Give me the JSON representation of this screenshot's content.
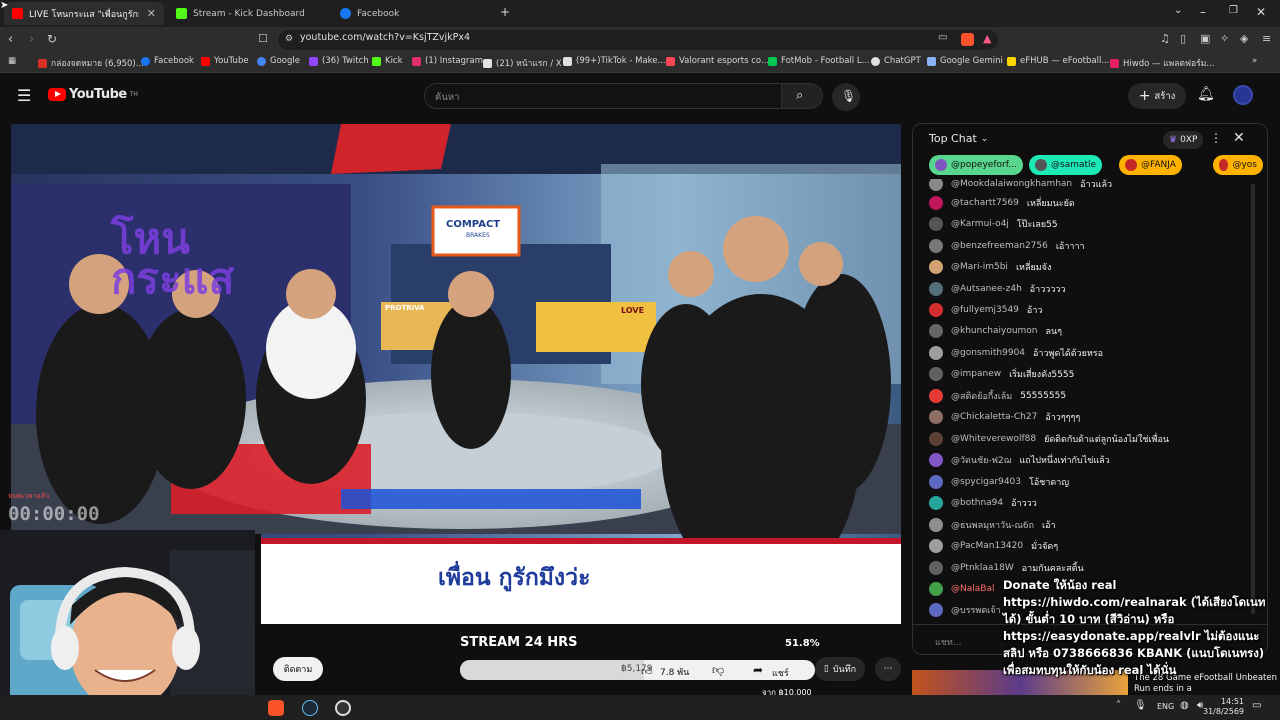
{
  "browser": {
    "tabs": [
      {
        "label": "LIVE โหนกระแส \"เพื่อนกูรักมึงว่ะ",
        "icon": "youtube-icon",
        "active": true
      },
      {
        "label": "Stream - Kick Dashboard",
        "icon": "kick-icon",
        "active": false
      },
      {
        "label": "Facebook",
        "icon": "facebook-icon",
        "active": false
      }
    ],
    "url": "youtube.com/watch?v=KsjTZvjkPx4",
    "bookmarks": [
      {
        "label": "กล่องจดหมาย (6,950)...",
        "color": "#d93025"
      },
      {
        "label": "Facebook",
        "color": "#1877f2"
      },
      {
        "label": "YouTube",
        "color": "#ff0000"
      },
      {
        "label": "Google",
        "color": "#4285f4"
      },
      {
        "label": "(36) Twitch",
        "color": "#9146ff"
      },
      {
        "label": "Kick",
        "color": "#53fc18"
      },
      {
        "label": "(1) Instagram",
        "color": "#e1306c"
      },
      {
        "label": "(21) หน้าแรก / X",
        "color": "#e0e0e0"
      },
      {
        "label": "(99+)TikTok - Make...",
        "color": "#e0e0e0"
      },
      {
        "label": "Valorant esports co...",
        "color": "#ff4655"
      },
      {
        "label": "FotMob - Football L...",
        "color": "#00c853"
      },
      {
        "label": "ChatGPT",
        "color": "#e0e0e0"
      },
      {
        "label": "Google Gemini",
        "color": "#8ab4f8"
      },
      {
        "label": "eFHUB — eFootball...",
        "color": "#ffd600"
      },
      {
        "label": "Hiwdo — แพลตฟอร์ม...",
        "color": "#e91e63"
      }
    ]
  },
  "youtube": {
    "logo": "YouTube",
    "logo_sup": "TH",
    "search_placeholder": "ค้นหา",
    "create_label": "สร้าง"
  },
  "video": {
    "headline": "เพื่อน กูรักมึงว่ะ",
    "sponsor": "COMPACT",
    "sponsor_sub": "BRAKES",
    "show_logo": "โหน กระแส",
    "timer": "00:00:00",
    "timer_label": "หมดเวลาแล้ว",
    "desk_items": [
      "PROTRIVA",
      "LOVE"
    ]
  },
  "below": {
    "subscribe_label": "ติดตาม",
    "stream_label": "STREAM 24 HRS",
    "percent": "51.8%",
    "progress_fraction": 0.518,
    "likes": "7.8 พัน",
    "share": "แชร์",
    "save": "บันทึก",
    "goal_label": "฿5,179",
    "goal_target": "จาก ฿10,000"
  },
  "chat": {
    "header": "Top Chat",
    "xp": "0XP",
    "pills": [
      {
        "name": "@popeyeforf...",
        "color": "#58d68d"
      },
      {
        "name": "@samatle",
        "color": "#1de9b6"
      },
      {
        "name": "@FANJA",
        "color": "#ffb300"
      },
      {
        "name": "@yos",
        "color": "#ffb300"
      }
    ],
    "messages": [
      {
        "user": "@Mookdalaiwongkhamhan",
        "text": "อ้าวแล้ว",
        "avatar": "#888888"
      },
      {
        "user": "@tachartt7569",
        "text": "เหลี่ยมนะยัด",
        "avatar": "#c2185b"
      },
      {
        "user": "@Karmui-o4j",
        "text": "โป๊ะเลย55",
        "avatar": "#555555"
      },
      {
        "user": "@benzefreeman2756",
        "text": "เอ้าาาา",
        "avatar": "#777777"
      },
      {
        "user": "@Mari-im5bi",
        "text": "เหลี่ยมจัง",
        "avatar": "#d4a373"
      },
      {
        "user": "@Autsanee-z4h",
        "text": "อ้าววววว",
        "avatar": "#546e7a"
      },
      {
        "user": "@fullyemj3549",
        "text": "อ้าว",
        "avatar": "#d32f2f"
      },
      {
        "user": "@khunchaiyoumon",
        "text": "ลนๆ",
        "avatar": "#666666"
      },
      {
        "user": "@gonsmith9904",
        "text": "อ้าวพูดได้ด้วยหรอ",
        "avatar": "#9e9e9e"
      },
      {
        "user": "@impanew",
        "text": "เริ่มเสี่ยงดัง5555",
        "avatar": "#616161"
      },
      {
        "user": "@สติดย้อกี้งเล้ม",
        "text": "55555555",
        "avatar": "#e53935"
      },
      {
        "user": "@Chickaletta-Ch27",
        "text": "อ้าวๆๆๆๆ",
        "avatar": "#8d6e63"
      },
      {
        "user": "@Whiteverewolf88",
        "text": "ยัดดิดกับด้าแต่ลูกน้องไม่ใช่เพื่อน",
        "avatar": "#5d4037"
      },
      {
        "user": "@วัดนชัย-ฟ2ฌ",
        "text": "แถไปหนึ่งเท่ากับไข่แล้ว",
        "avatar": "#7e57c2"
      },
      {
        "user": "@spycigar9403",
        "text": "โอ้ชาดาญ",
        "avatar": "#5c6bc0"
      },
      {
        "user": "@bothna94",
        "text": "อ้าววว",
        "avatar": "#26a69a"
      },
      {
        "user": "@ธนพลมุหาวัน-ณ6ถ",
        "text": "เอ้า",
        "avatar": "#8e8e8e"
      },
      {
        "user": "@PacMan13420",
        "text": "มั่วจัดๆ",
        "avatar": "#9e9e9e"
      },
      {
        "user": "@Ptnklaa18W",
        "text": "อามกันคละสติ้น",
        "avatar": "#616161"
      },
      {
        "user": "@NalaBal",
        "text": "",
        "avatar": "#43a047"
      },
      {
        "user": "@บรรพตเจ้า",
        "text": "",
        "avatar": "#5c6bc0"
      }
    ],
    "input_placeholder": "แชท..."
  },
  "donation": {
    "text": "Donate ให้น้อง real https://hiwdo.com/realnarak (ได้เสียงโดเนทได้) ขั้นต่ำ 10 บาท (สีวิอ่าน) หรือ https://easydonate.app/realvlr ไม่ต้องแนะสลิป หรือ 0738666836 KBANK (แนบโดเนทรง) เพื่อสมทบทุนให้กับน้อง real ได้นั่น"
  },
  "next_video": {
    "title": "The 28 Game eFootball Unbeaten Run ends in a"
  },
  "taskbar": {
    "lang": "ENG",
    "time": "14:51",
    "date": "31/8/2569"
  }
}
